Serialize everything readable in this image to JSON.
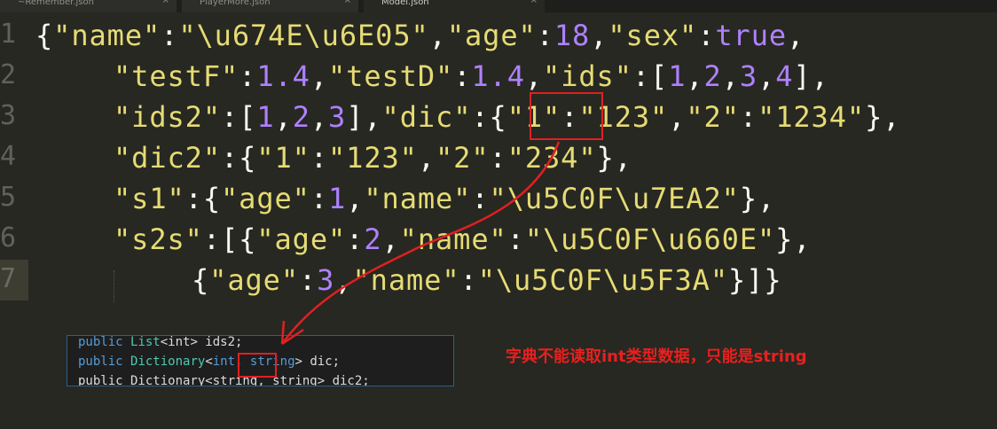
{
  "tabs": [
    {
      "label": "~Remember.json",
      "close": "×"
    },
    {
      "label": "PlayerMore.json",
      "close": "×"
    },
    {
      "label": "Model.json",
      "close": "×"
    }
  ],
  "line_numbers": [
    "1",
    "2",
    "3",
    "4",
    "5",
    "6",
    "7"
  ],
  "code": {
    "l1": [
      {
        "t": "{",
        "c": "p"
      },
      {
        "t": "\"name\"",
        "c": "s"
      },
      {
        "t": ":",
        "c": "p"
      },
      {
        "t": "\"\\u674E\\u6E05\"",
        "c": "s"
      },
      {
        "t": ",",
        "c": "p"
      },
      {
        "t": "\"age\"",
        "c": "s"
      },
      {
        "t": ":",
        "c": "p"
      },
      {
        "t": "18",
        "c": "n"
      },
      {
        "t": ",",
        "c": "p"
      },
      {
        "t": "\"sex\"",
        "c": "s"
      },
      {
        "t": ":",
        "c": "p"
      },
      {
        "t": "true",
        "c": "n"
      },
      {
        "t": ",",
        "c": "p"
      }
    ],
    "l2": [
      {
        "t": "\"testF\"",
        "c": "s"
      },
      {
        "t": ":",
        "c": "p"
      },
      {
        "t": "1.4",
        "c": "n"
      },
      {
        "t": ",",
        "c": "p"
      },
      {
        "t": "\"testD\"",
        "c": "s"
      },
      {
        "t": ":",
        "c": "p"
      },
      {
        "t": "1.4",
        "c": "n"
      },
      {
        "t": ",",
        "c": "p"
      },
      {
        "t": "\"ids\"",
        "c": "s"
      },
      {
        "t": ":[",
        "c": "p"
      },
      {
        "t": "1",
        "c": "n"
      },
      {
        "t": ",",
        "c": "p"
      },
      {
        "t": "2",
        "c": "n"
      },
      {
        "t": ",",
        "c": "p"
      },
      {
        "t": "3",
        "c": "n"
      },
      {
        "t": ",",
        "c": "p"
      },
      {
        "t": "4",
        "c": "n"
      },
      {
        "t": "],",
        "c": "p"
      }
    ],
    "l3": [
      {
        "t": "\"ids2\"",
        "c": "s"
      },
      {
        "t": ":[",
        "c": "p"
      },
      {
        "t": "1",
        "c": "n"
      },
      {
        "t": ",",
        "c": "p"
      },
      {
        "t": "2",
        "c": "n"
      },
      {
        "t": ",",
        "c": "p"
      },
      {
        "t": "3",
        "c": "n"
      },
      {
        "t": "],",
        "c": "p"
      },
      {
        "t": "\"dic\"",
        "c": "s"
      },
      {
        "t": ":{",
        "c": "p"
      },
      {
        "t": "\"1\"",
        "c": "s"
      },
      {
        "t": ":",
        "c": "p"
      },
      {
        "t": "\"123\"",
        "c": "s"
      },
      {
        "t": ",",
        "c": "p"
      },
      {
        "t": "\"2\"",
        "c": "s"
      },
      {
        "t": ":",
        "c": "p"
      },
      {
        "t": "\"1234\"",
        "c": "s"
      },
      {
        "t": "},",
        "c": "p"
      }
    ],
    "l4": [
      {
        "t": "\"dic2\"",
        "c": "s"
      },
      {
        "t": ":{",
        "c": "p"
      },
      {
        "t": "\"1\"",
        "c": "s"
      },
      {
        "t": ":",
        "c": "p"
      },
      {
        "t": "\"123\"",
        "c": "s"
      },
      {
        "t": ",",
        "c": "p"
      },
      {
        "t": "\"2\"",
        "c": "s"
      },
      {
        "t": ":",
        "c": "p"
      },
      {
        "t": "\"234\"",
        "c": "s"
      },
      {
        "t": "},",
        "c": "p"
      }
    ],
    "l5": [
      {
        "t": "\"s1\"",
        "c": "s"
      },
      {
        "t": ":{",
        "c": "p"
      },
      {
        "t": "\"age\"",
        "c": "s"
      },
      {
        "t": ":",
        "c": "p"
      },
      {
        "t": "1",
        "c": "n"
      },
      {
        "t": ",",
        "c": "p"
      },
      {
        "t": "\"name\"",
        "c": "s"
      },
      {
        "t": ":",
        "c": "p"
      },
      {
        "t": "\"\\u5C0F\\u7EA2\"",
        "c": "s"
      },
      {
        "t": "},",
        "c": "p"
      }
    ],
    "l6": [
      {
        "t": "\"s2s\"",
        "c": "s"
      },
      {
        "t": ":[{",
        "c": "p"
      },
      {
        "t": "\"age\"",
        "c": "s"
      },
      {
        "t": ":",
        "c": "p"
      },
      {
        "t": "2",
        "c": "n"
      },
      {
        "t": ",",
        "c": "p"
      },
      {
        "t": "\"name\"",
        "c": "s"
      },
      {
        "t": ":",
        "c": "p"
      },
      {
        "t": "\"\\u5C0F\\u660E\"",
        "c": "s"
      },
      {
        "t": "},",
        "c": "p"
      }
    ],
    "l7": [
      {
        "t": "{",
        "c": "p"
      },
      {
        "t": "\"age\"",
        "c": "s"
      },
      {
        "t": ":",
        "c": "p"
      },
      {
        "t": "3",
        "c": "n"
      },
      {
        "t": ",",
        "c": "p"
      },
      {
        "t": "\"name\"",
        "c": "s"
      },
      {
        "t": ":",
        "c": "p"
      },
      {
        "t": "\"\\u5C0F\\u5F3A\"",
        "c": "s"
      },
      {
        "t": "}]}",
        "c": "p"
      }
    ]
  },
  "csharp": {
    "line1": {
      "kw": "public",
      "ty": "List",
      "rest": "<int> ids2;"
    },
    "line2": {
      "kw": "public",
      "ty": "Dictionary",
      "lt": "<",
      "hl": "int",
      "comma": ",",
      "sp": " ",
      "kw2": "string",
      "rest": "> dic;"
    },
    "line3": {
      "text": "public Dictionary<string, string> dic2;"
    }
  },
  "annotation": "字典不能读取int类型数据，只能是string",
  "colors": {
    "bg": "#272822",
    "string": "#e6db74",
    "number": "#ae81ff",
    "annotation": "#e8201e"
  }
}
